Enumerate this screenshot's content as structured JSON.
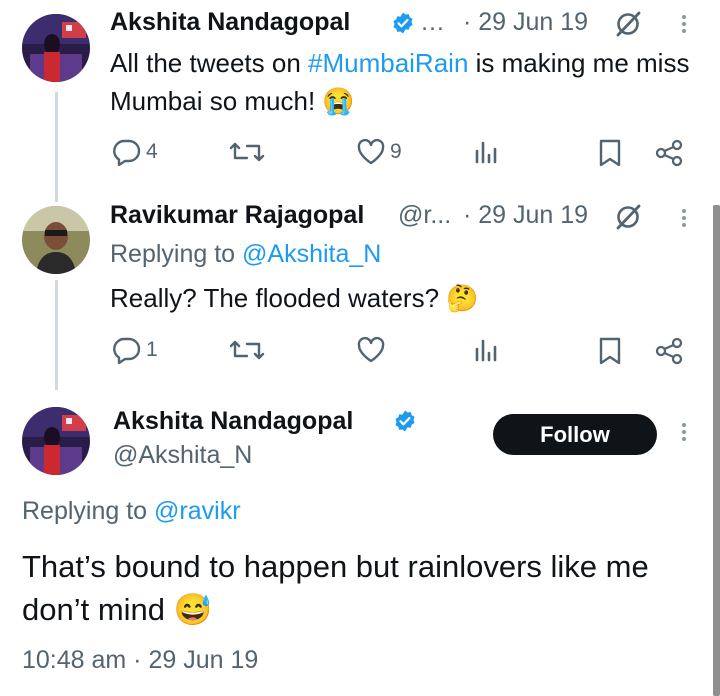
{
  "tweets": [
    {
      "display_name": "Akshita Nandagopal",
      "handle_truncated": "…",
      "time": "· 29 Jun 19",
      "text_before": "All the tweets on ",
      "hashtag": "#MumbaiRain",
      "text_after": " is making me miss Mumbai so much! 😭",
      "replies": "4",
      "likes": "9"
    },
    {
      "display_name": "Ravikumar Rajagopal",
      "handle_truncated": "@r...",
      "time": "· 29 Jun 19",
      "replying_label": "Replying to ",
      "replying_to": "@Akshita_N",
      "text": "Really? The flooded waters? 🤔",
      "replies": "1",
      "likes": ""
    }
  ],
  "focused": {
    "display_name": "Akshita Nandagopal",
    "handle": "@Akshita_N",
    "follow_label": "Follow",
    "replying_label": "Replying to ",
    "replying_to": "@ravikr",
    "text": "That’s bound to happen but rainlovers like me don’t mind 😅",
    "timestamp": "10:48 am · 29 Jun 19"
  },
  "colors": {
    "accent": "#1d9bf0",
    "text": "#0f1419",
    "muted": "#536471",
    "verified": "#1d9bf0"
  },
  "icons": [
    "verified-badge-icon",
    "grok-icon",
    "more-icon",
    "reply-icon",
    "retweet-icon",
    "like-icon",
    "views-icon",
    "bookmark-icon",
    "share-icon"
  ]
}
